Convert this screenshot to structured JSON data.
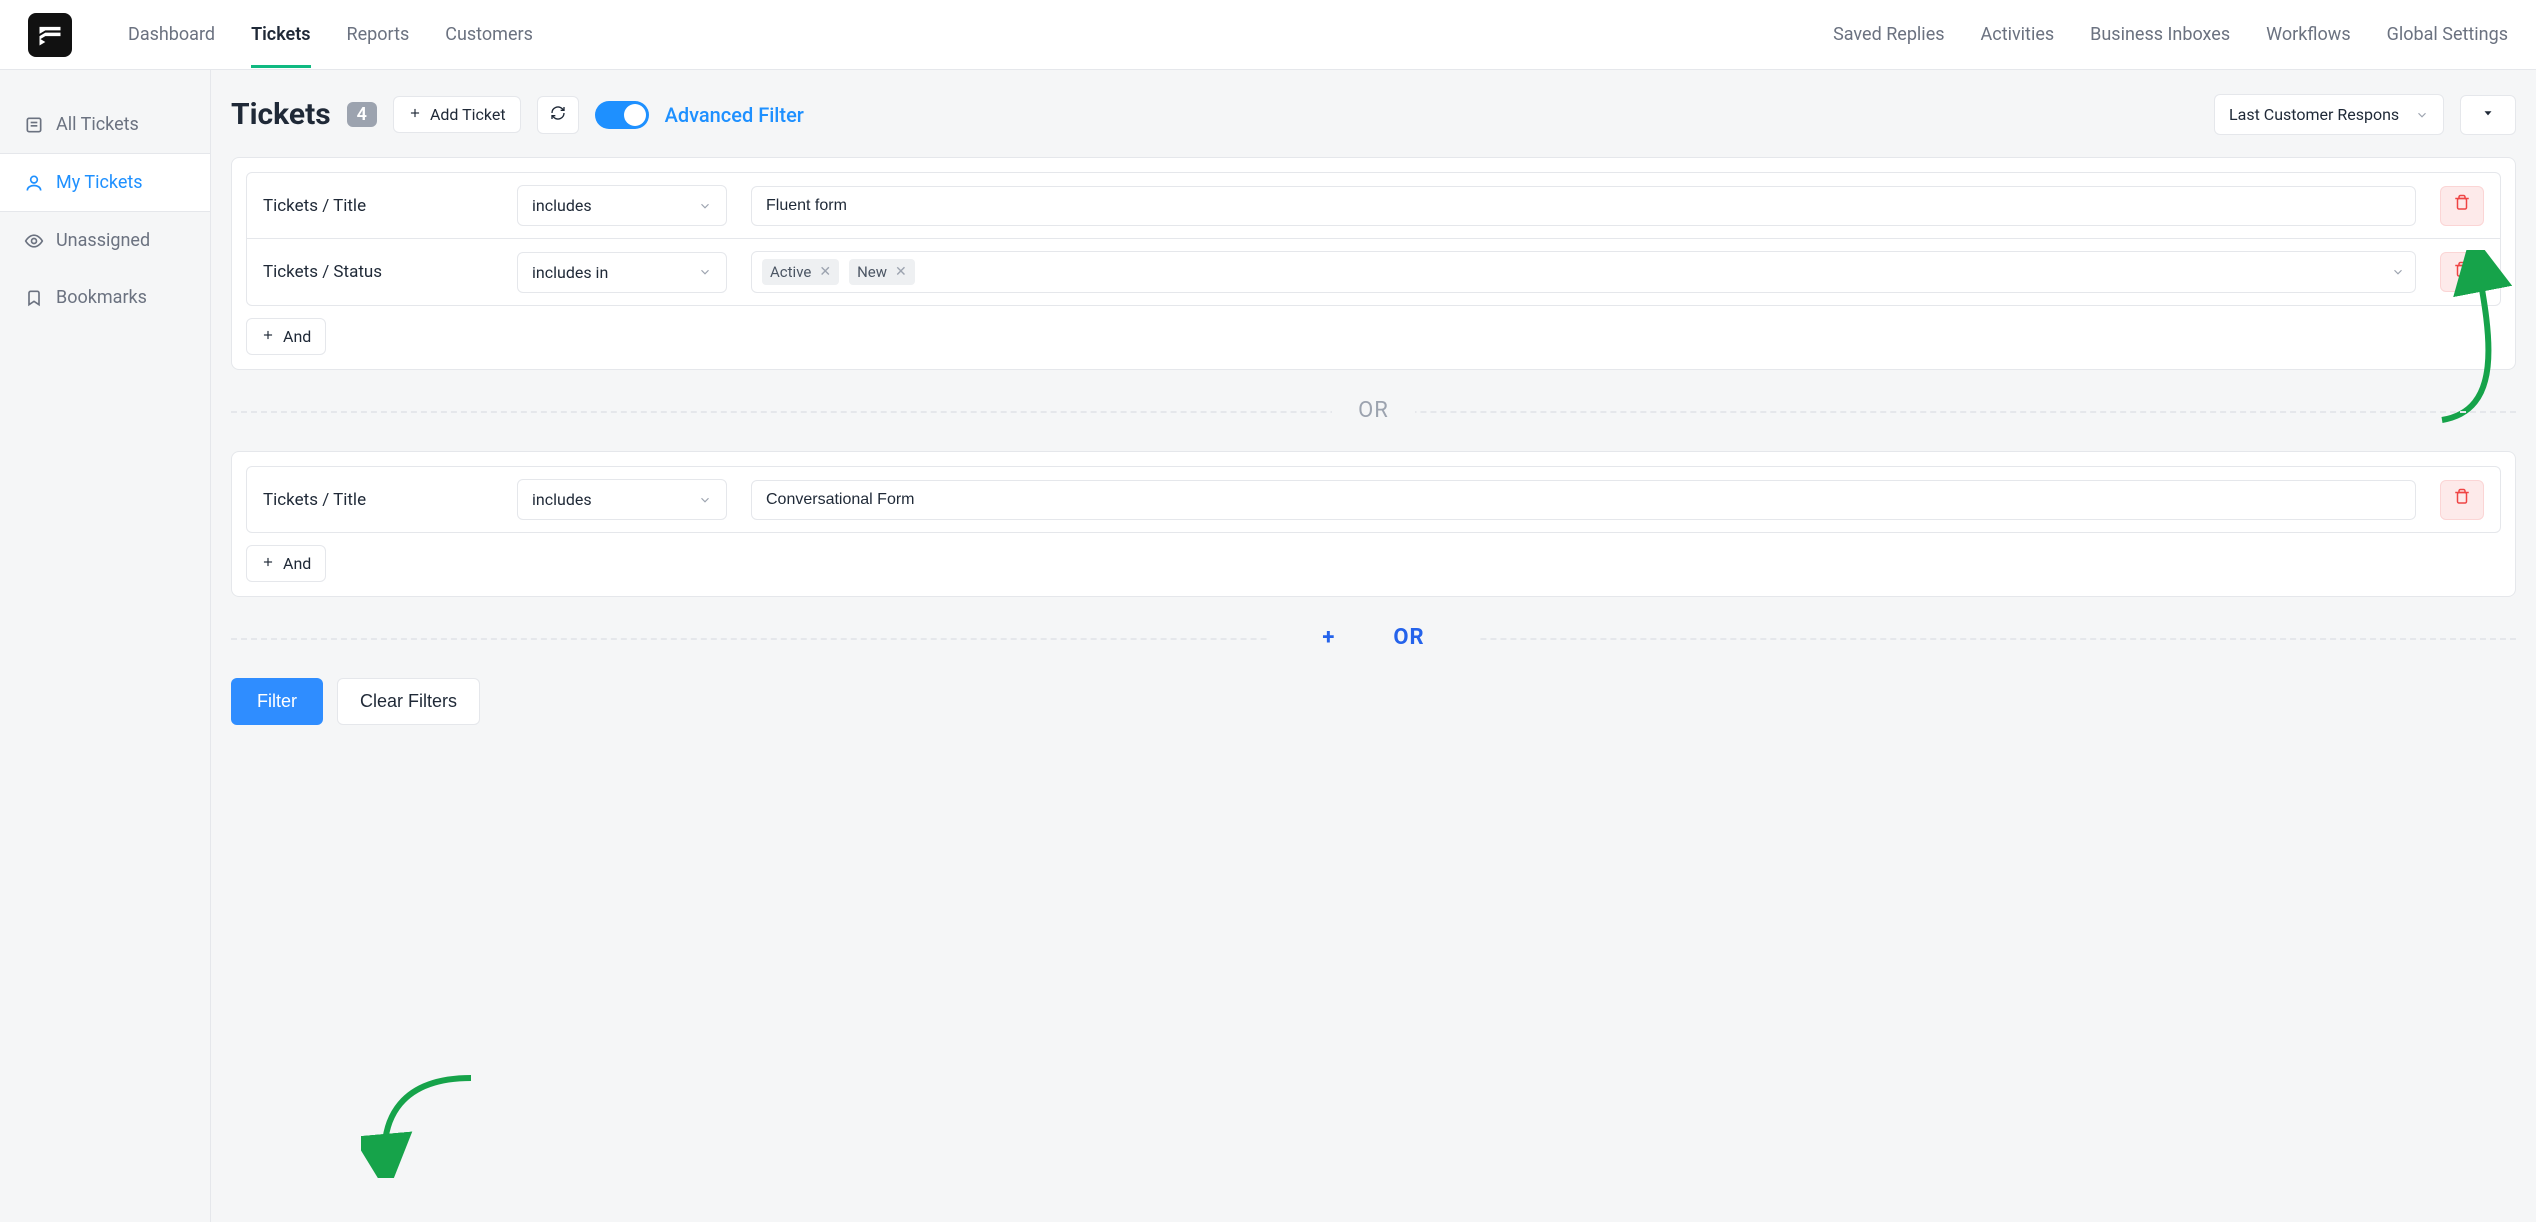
{
  "nav": {
    "left": [
      "Dashboard",
      "Tickets",
      "Reports",
      "Customers"
    ],
    "active_index": 1,
    "right": [
      "Saved Replies",
      "Activities",
      "Business Inboxes",
      "Workflows",
      "Global Settings"
    ]
  },
  "sidebar": {
    "items": [
      {
        "label": "All Tickets",
        "icon": "list-icon"
      },
      {
        "label": "My Tickets",
        "icon": "user-icon"
      },
      {
        "label": "Unassigned",
        "icon": "eye-icon"
      },
      {
        "label": "Bookmarks",
        "icon": "bookmark-icon"
      }
    ],
    "active_index": 1
  },
  "header": {
    "title": "Tickets",
    "count": "4",
    "add_label": "Add Ticket",
    "advanced_filter_label": "Advanced Filter",
    "advanced_filter_on": true,
    "sort_label": "Last Customer Respons"
  },
  "filters": {
    "groups": [
      {
        "rules": [
          {
            "field": "Tickets / Title",
            "operator": "includes",
            "value_type": "text",
            "value": "Fluent form"
          },
          {
            "field": "Tickets / Status",
            "operator": "includes in",
            "value_type": "tags",
            "tags": [
              "Active",
              "New"
            ]
          }
        ]
      },
      {
        "rules": [
          {
            "field": "Tickets / Title",
            "operator": "includes",
            "value_type": "text",
            "value": "Conversational Form"
          }
        ]
      }
    ],
    "or_label": "OR",
    "add_or_label": "OR",
    "and_label": "And"
  },
  "actions": {
    "apply": "Filter",
    "clear": "Clear Filters"
  }
}
